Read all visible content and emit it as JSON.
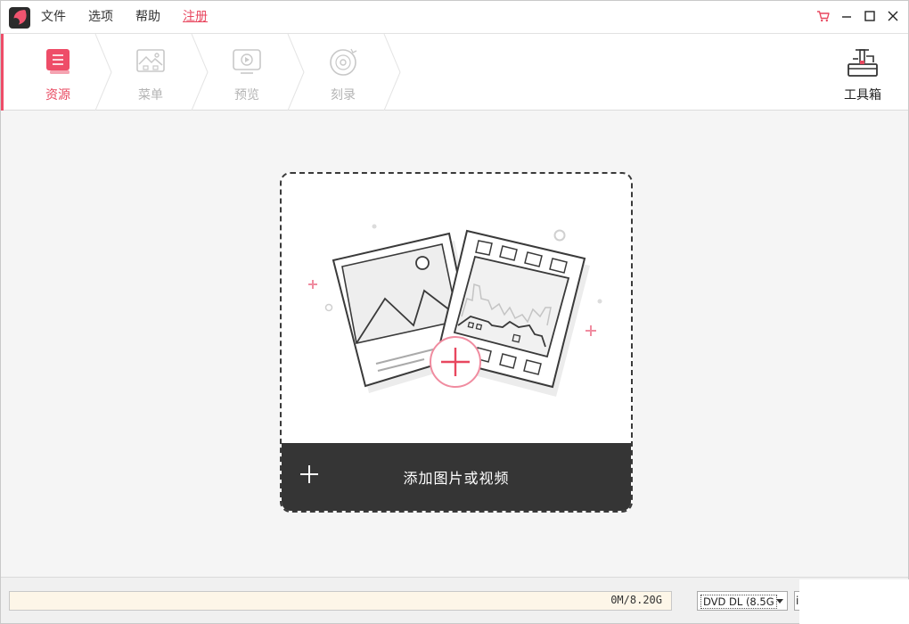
{
  "menu": {
    "file": "文件",
    "options": "选项",
    "help": "帮助",
    "register": "注册"
  },
  "window_controls": [
    "cart-icon",
    "minimize-icon",
    "maximize-icon",
    "close-icon"
  ],
  "steps": [
    {
      "label": "资源",
      "icon": "resource-icon",
      "active": true
    },
    {
      "label": "菜单",
      "icon": "menu-image-icon",
      "active": false
    },
    {
      "label": "预览",
      "icon": "preview-tv-icon",
      "active": false
    },
    {
      "label": "刻录",
      "icon": "burn-disc-icon",
      "active": false
    }
  ],
  "toolbox": {
    "label": "工具箱",
    "icon": "toolbox-icon"
  },
  "dropzone": {
    "add_label": "添加图片或视频",
    "illustration": "photo-and-film-illustration"
  },
  "status": {
    "capacity_text": "0M/8.20G",
    "capacity_used_fraction": 0,
    "disc_type": "DVD DL (8.5G",
    "quality_partial": "i"
  },
  "colors": {
    "accent": "#e8475f",
    "dark_bar": "#353535",
    "inactive": "#b4b4b4",
    "capacity_bg": "#fdf6e8"
  }
}
